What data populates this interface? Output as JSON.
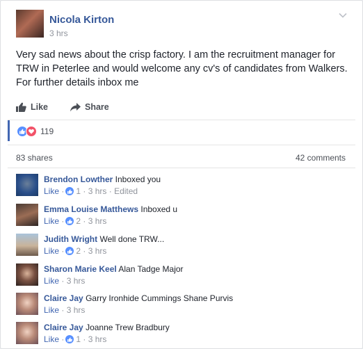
{
  "post": {
    "author": "Nicola Kirton",
    "time": "3 hrs",
    "text": "Very sad news about the crisp factory. I am the recruitment manager for TRW in Peterlee and would welcome any cv's of candidates from Walkers. For further details inbox me",
    "like_label": "Like",
    "share_label": "Share",
    "reactions_count": "119",
    "shares": "83 shares",
    "comments": "42 comments"
  },
  "comments": [
    {
      "name": "Brendon Lowther",
      "text": "Inboxed you",
      "like": "Like",
      "likes": "1",
      "time": "3 hrs",
      "edited": "Edited"
    },
    {
      "name": "Emma Louise Matthews",
      "text": "Inboxed u",
      "like": "Like",
      "likes": "2",
      "time": "3 hrs"
    },
    {
      "name": "Judith Wright",
      "text": "Well done TRW...",
      "like": "Like",
      "likes": "2",
      "time": "3 hrs"
    },
    {
      "name": "Sharon Marie Keel",
      "text": "Alan Tadge Major",
      "like": "Like",
      "time": "3 hrs"
    },
    {
      "name": "Claire Jay",
      "text": "Garry Ironhide Cummings Shane Purvis",
      "like": "Like",
      "time": "3 hrs"
    },
    {
      "name": "Claire Jay",
      "text": "Joanne Trew Bradbury",
      "like": "Like",
      "likes": "1",
      "time": "3 hrs"
    }
  ],
  "colors": {
    "accent": "#365899",
    "like_blue": "#5890ff",
    "love_red": "#f25268",
    "meta_gray": "#90949c"
  },
  "icons": [
    "chevron-down-icon",
    "thumbs-up-icon",
    "share-arrow-icon",
    "like-reaction-icon",
    "love-reaction-icon"
  ]
}
